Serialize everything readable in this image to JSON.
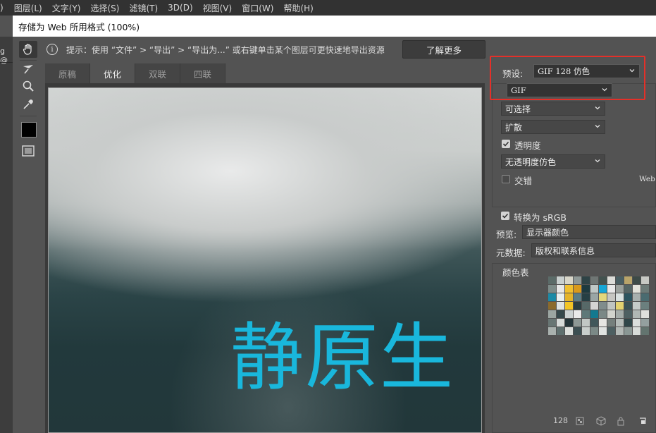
{
  "menubar": {
    "items": [
      ")",
      "图层(L)",
      "文字(Y)",
      "选择(S)",
      "滤镜(T)",
      "3D(D)",
      "视图(V)",
      "窗口(W)",
      "帮助(H)"
    ]
  },
  "window": {
    "title": "存储为 Web 所用格式 (100%)"
  },
  "left_strip": {
    "tab_fragment": "g @"
  },
  "hint": {
    "text": "提示：使用 “文件” > “导出” > “导出为...” 或右键单击某个图层可更快速地导出资源",
    "learn_more": "了解更多"
  },
  "view_tabs": [
    "原稿",
    "优化",
    "双联",
    "四联"
  ],
  "active_tab": "优化",
  "canvas": {
    "overlay_text": "静原生"
  },
  "settings": {
    "preset_label": "预设:",
    "preset_value": "GIF 128 仿色",
    "format_value": "GIF",
    "reduction_value": "可选择",
    "dither_value": "扩散",
    "transparency_label": "透明度",
    "transparency_checked": true,
    "transparency_dither_value": "无透明度仿色",
    "interlaced_label": "交错",
    "interlaced_checked": false,
    "web_snap_fragment": "Web",
    "convert_srgb_label": "转换为 sRGB",
    "convert_srgb_checked": true,
    "preview_label": "预览:",
    "preview_value": "显示器颜色",
    "metadata_label": "元数据:",
    "metadata_value": "版权和联系信息",
    "color_table_label": "颜色表",
    "color_count": "128"
  },
  "colors": {
    "highlight_box": "#e43029",
    "overlay_text": "#19b7dc",
    "palette": [
      "#5b6b68",
      "#c9d0cf",
      "#d8d6c9",
      "#8e9896",
      "#2e4346",
      "#6f7674",
      "#43524f",
      "#dcdcd8",
      "#4a5f63",
      "#b9a46a",
      "#3d4a47",
      "#c8c9c4",
      "#7d8b88",
      "#e8e8e8",
      "#f0c030",
      "#d99a1c",
      "#1e3a3f",
      "#c0c8c6",
      "#16a6d6",
      "#e8e8e8",
      "#9aa09c",
      "#556564",
      "#e2e2da",
      "#6d7b78",
      "#1b8aa6",
      "#e8f0f0",
      "#e4b42a",
      "#5b7d84",
      "#263f44",
      "#9aa6a5",
      "#e3d77c",
      "#c6c6c2",
      "#d9e1e0",
      "#2c5560",
      "#a8b0ae",
      "#4a6b70",
      "#8b6a2c",
      "#dfe3e2",
      "#f3c525",
      "#2b3f42",
      "#576968",
      "#d4d4d4",
      "#7f8c8c",
      "#bfc4c1",
      "#e3d270",
      "#3a5256",
      "#c5cbc9",
      "#6b7f7e",
      "#9ca6a2",
      "#36494c",
      "#cbd2d2",
      "#e9eaea",
      "#5e7878",
      "#13798f",
      "#7a8886",
      "#d1d3cd",
      "#a4aca9",
      "#4e6062",
      "#b1b7b4",
      "#e0e0dc",
      "#687674",
      "#d6dbd9",
      "#24363a",
      "#8d9895",
      "#c2c7c4",
      "#41575a",
      "#e6e6e2",
      "#757f7c",
      "#b5bcb9",
      "#2f4649",
      "#dadedc",
      "#94a09f",
      "#a9b1ae",
      "#5f706f",
      "#dcdfdc",
      "#3c4f52",
      "#c9cecb",
      "#7b8986",
      "#e0e3e1",
      "#4d5f61",
      "#b3b9b6",
      "#8a9794",
      "#d8dcd9",
      "#63746f"
    ]
  }
}
